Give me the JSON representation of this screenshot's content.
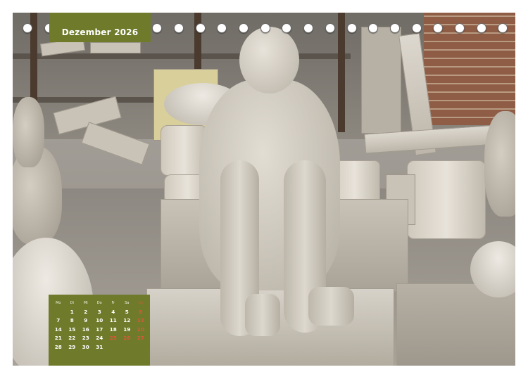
{
  "calendar_page": {
    "title": "Dezember 2026",
    "weekday_headers": [
      "Mo",
      "Di",
      "Mi",
      "Do",
      "Fr",
      "Sa",
      "So"
    ],
    "weeks": [
      [
        "",
        "1",
        "2",
        "3",
        "4",
        "5",
        "6"
      ],
      [
        "7",
        "8",
        "9",
        "10",
        "11",
        "12",
        "13"
      ],
      [
        "14",
        "15",
        "16",
        "17",
        "18",
        "19",
        "20"
      ],
      [
        "21",
        "22",
        "23",
        "24",
        "25",
        "26",
        "27"
      ],
      [
        "28",
        "29",
        "30",
        "31",
        "",
        "",
        ""
      ]
    ],
    "highlighted_days": [
      "6",
      "13",
      "20",
      "25",
      "26",
      "27"
    ],
    "colors": {
      "box_background": "#6f7b2b",
      "text": "#ffffff",
      "highlight": "#e0553a"
    }
  },
  "photo": {
    "subject": "plaster-cast-seated-figure"
  },
  "binding": {
    "ring_count": 23
  }
}
